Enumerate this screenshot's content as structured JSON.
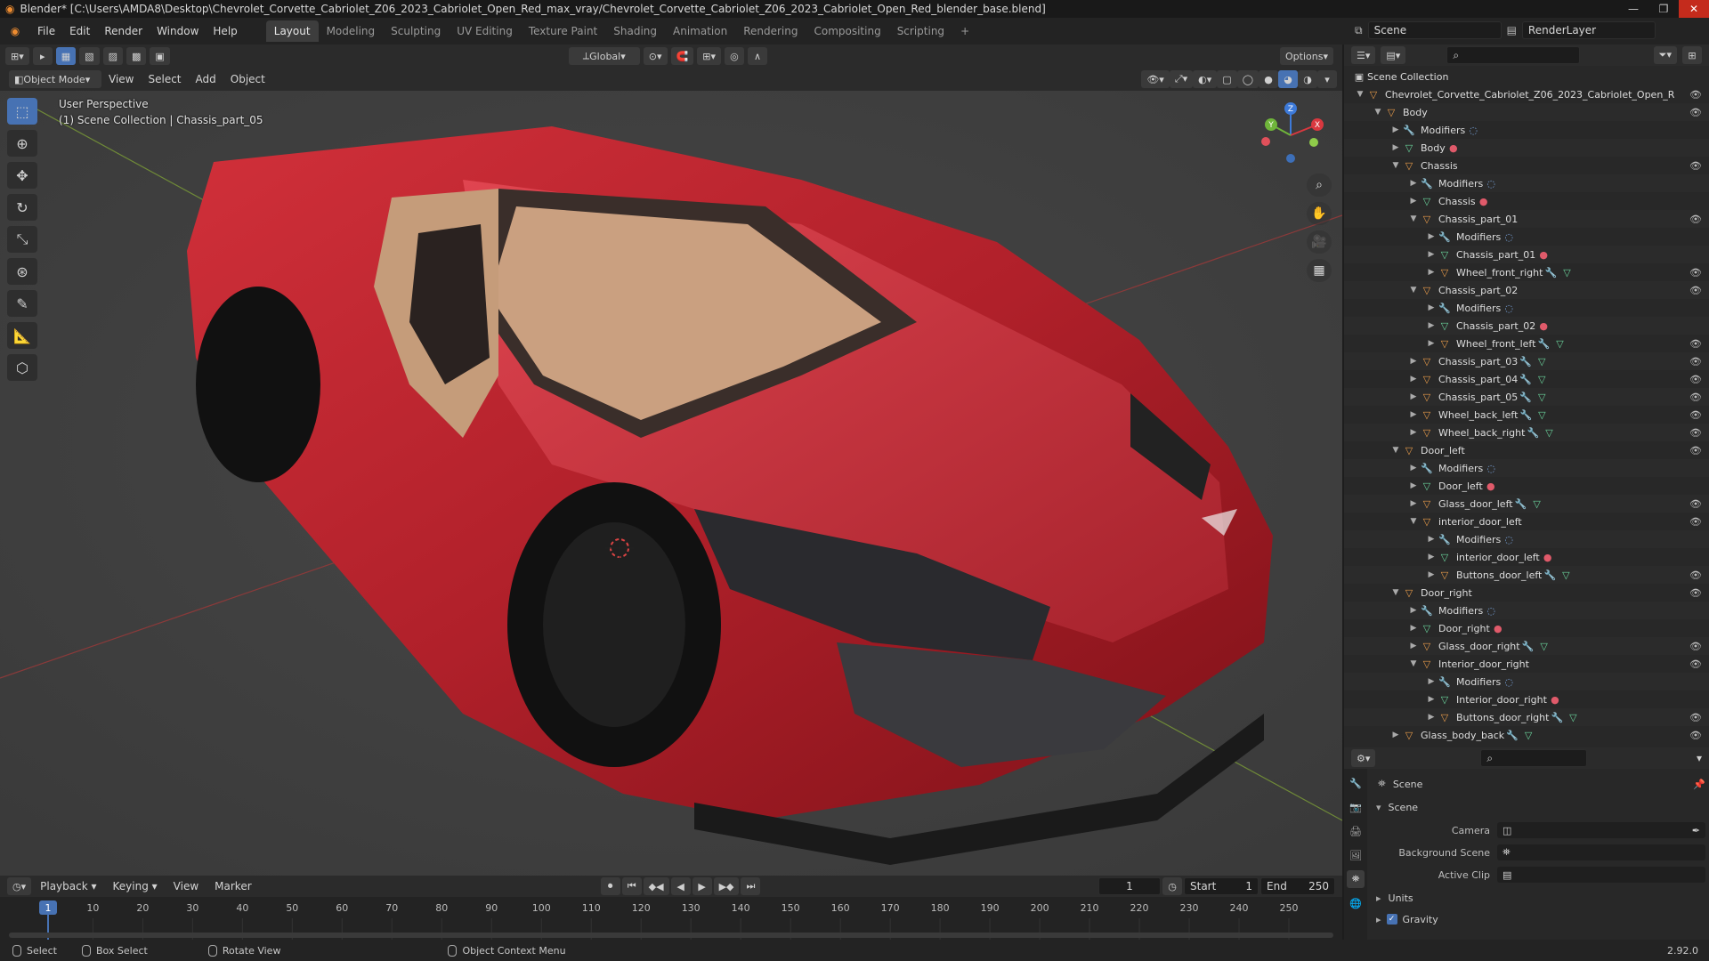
{
  "window": {
    "title": "Blender* [C:\\Users\\AMDA8\\Desktop\\Chevrolet_Corvette_Cabriolet_Z06_2023_Cabriolet_Open_Red_max_vray/Chevrolet_Corvette_Cabriolet_Z06_2023_Cabriolet_Open_Red_blender_base.blend]"
  },
  "menu": [
    "File",
    "Edit",
    "Render",
    "Window",
    "Help"
  ],
  "workspaces": [
    "Layout",
    "Modeling",
    "Sculpting",
    "UV Editing",
    "Texture Paint",
    "Shading",
    "Animation",
    "Rendering",
    "Compositing",
    "Scripting"
  ],
  "active_workspace": "Layout",
  "scene_selector": {
    "scene": "Scene",
    "view_layer": "RenderLayer"
  },
  "viewport_header": {
    "transform_orientation": "Global",
    "options": "Options",
    "mode": "Object Mode",
    "menus": [
      "View",
      "Select",
      "Add",
      "Object"
    ]
  },
  "viewport_info": {
    "line1": "User Perspective",
    "line2": "(1) Scene Collection | Chassis_part_05"
  },
  "gizmo": {
    "x": "X",
    "y": "Y",
    "z": "Z"
  },
  "timeline": {
    "menus": [
      "Playback",
      "Keying",
      "View",
      "Marker"
    ],
    "current_frame": "1",
    "start_label": "Start",
    "start": "1",
    "end_label": "End",
    "end": "250",
    "ticks": [
      "1",
      "10",
      "20",
      "30",
      "40",
      "50",
      "60",
      "70",
      "80",
      "90",
      "100",
      "110",
      "120",
      "130",
      "140",
      "150",
      "160",
      "170",
      "180",
      "190",
      "200",
      "210",
      "220",
      "230",
      "240",
      "250"
    ]
  },
  "statusbar": {
    "select": "Select",
    "box_select": "Box Select",
    "rotate": "Rotate View",
    "context": "Object Context Menu",
    "version": "2.92.0"
  },
  "outliner": {
    "root": "Scene Collection",
    "rows": [
      {
        "depth": 0,
        "label": "Chevrolet_Corvette_Cabriolet_Z06_2023_Cabriolet_Open_R",
        "type": "obj",
        "open": true,
        "eye": true
      },
      {
        "depth": 1,
        "label": "Body",
        "type": "obj",
        "open": true,
        "eye": true
      },
      {
        "depth": 2,
        "label": "Modifiers",
        "type": "mod",
        "open": false
      },
      {
        "depth": 2,
        "label": "Body",
        "type": "mesh",
        "open": false
      },
      {
        "depth": 2,
        "label": "Chassis",
        "type": "obj",
        "open": true,
        "eye": true
      },
      {
        "depth": 3,
        "label": "Modifiers",
        "type": "mod",
        "open": false
      },
      {
        "depth": 3,
        "label": "Chassis",
        "type": "mesh",
        "open": false
      },
      {
        "depth": 3,
        "label": "Chassis_part_01",
        "type": "obj",
        "open": true,
        "eye": true
      },
      {
        "depth": 4,
        "label": "Modifiers",
        "type": "mod",
        "open": false
      },
      {
        "depth": 4,
        "label": "Chassis_part_01",
        "type": "mesh",
        "open": false
      },
      {
        "depth": 4,
        "label": "Wheel_front_right",
        "type": "obj",
        "open": false,
        "eye": true
      },
      {
        "depth": 3,
        "label": "Chassis_part_02",
        "type": "obj",
        "open": true,
        "eye": true
      },
      {
        "depth": 4,
        "label": "Modifiers",
        "type": "mod",
        "open": false
      },
      {
        "depth": 4,
        "label": "Chassis_part_02",
        "type": "mesh",
        "open": false
      },
      {
        "depth": 4,
        "label": "Wheel_front_left",
        "type": "obj",
        "open": false,
        "eye": true
      },
      {
        "depth": 3,
        "label": "Chassis_part_03",
        "type": "obj",
        "open": false,
        "eye": true
      },
      {
        "depth": 3,
        "label": "Chassis_part_04",
        "type": "obj",
        "open": false,
        "eye": true
      },
      {
        "depth": 3,
        "label": "Chassis_part_05",
        "type": "obj",
        "open": false,
        "eye": true
      },
      {
        "depth": 3,
        "label": "Wheel_back_left",
        "type": "obj",
        "open": false,
        "eye": true
      },
      {
        "depth": 3,
        "label": "Wheel_back_right",
        "type": "obj",
        "open": false,
        "eye": true
      },
      {
        "depth": 2,
        "label": "Door_left",
        "type": "obj",
        "open": true,
        "eye": true
      },
      {
        "depth": 3,
        "label": "Modifiers",
        "type": "mod",
        "open": false
      },
      {
        "depth": 3,
        "label": "Door_left",
        "type": "mesh",
        "open": false
      },
      {
        "depth": 3,
        "label": "Glass_door_left",
        "type": "obj",
        "open": false,
        "eye": true
      },
      {
        "depth": 3,
        "label": "interior_door_left",
        "type": "obj",
        "open": true,
        "eye": true
      },
      {
        "depth": 4,
        "label": "Modifiers",
        "type": "mod",
        "open": false
      },
      {
        "depth": 4,
        "label": "interior_door_left",
        "type": "mesh",
        "open": false
      },
      {
        "depth": 4,
        "label": "Buttons_door_left",
        "type": "obj",
        "open": false,
        "eye": true
      },
      {
        "depth": 2,
        "label": "Door_right",
        "type": "obj",
        "open": true,
        "eye": true
      },
      {
        "depth": 3,
        "label": "Modifiers",
        "type": "mod",
        "open": false
      },
      {
        "depth": 3,
        "label": "Door_right",
        "type": "mesh",
        "open": false
      },
      {
        "depth": 3,
        "label": "Glass_door_right",
        "type": "obj",
        "open": false,
        "eye": true
      },
      {
        "depth": 3,
        "label": "Interior_door_right",
        "type": "obj",
        "open": true,
        "eye": true
      },
      {
        "depth": 4,
        "label": "Modifiers",
        "type": "mod",
        "open": false
      },
      {
        "depth": 4,
        "label": "Interior_door_right",
        "type": "mesh",
        "open": false
      },
      {
        "depth": 4,
        "label": "Buttons_door_right",
        "type": "obj",
        "open": false,
        "eye": true
      },
      {
        "depth": 2,
        "label": "Glass_body_back",
        "type": "obj",
        "open": false,
        "eye": true
      }
    ]
  },
  "properties": {
    "header": "Scene",
    "section": "Scene",
    "camera_label": "Camera",
    "background_label": "Background Scene",
    "clip_label": "Active Clip",
    "units": "Units",
    "gravity": "Gravity"
  }
}
